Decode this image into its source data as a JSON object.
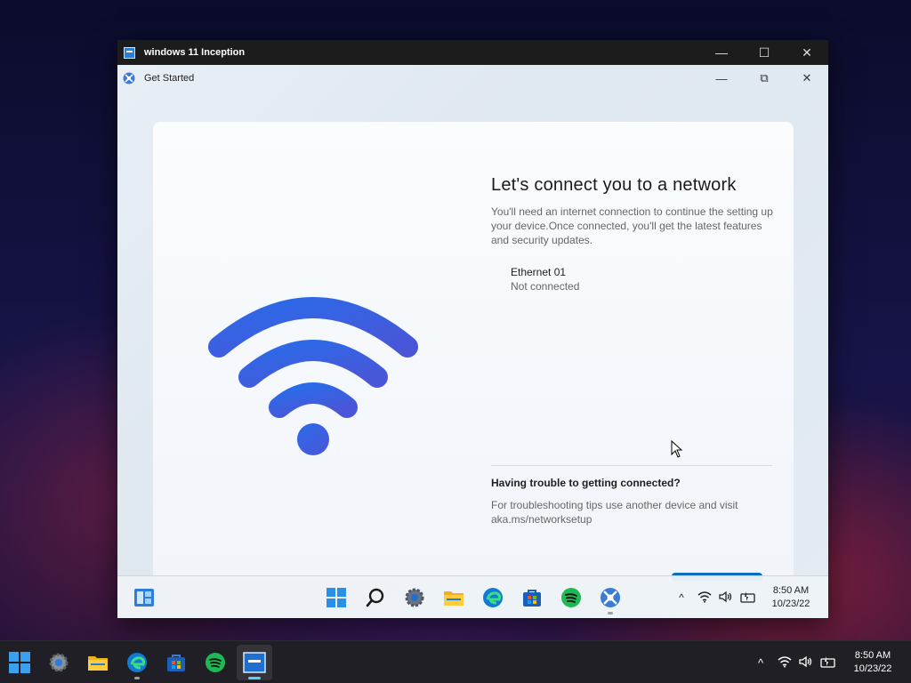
{
  "vm_window": {
    "title": "windows 11 Inception",
    "controls": {
      "minimize": "—",
      "maximize": "☐",
      "close": "✕"
    }
  },
  "oobe": {
    "title": "Get Started",
    "controls": {
      "minimize": "—",
      "restore": "⧉",
      "close": "✕"
    },
    "heading": "Let's connect you to a network",
    "description": "You'll need an internet connection to continue the setting up your device.Once connected, you'll get the latest features and security updates.",
    "network": {
      "name": "Ethernet 01",
      "status": "Not connected"
    },
    "trouble": {
      "title": "Having trouble to getting connected?",
      "text": "For troubleshooting tips use another device and visit aka.ms/networksetup"
    }
  },
  "guest_taskbar": {
    "apps": [
      "start-icon",
      "search-icon",
      "settings-icon",
      "file-explorer-icon",
      "edge-icon",
      "store-icon",
      "spotify-icon",
      "get-started-icon"
    ],
    "tray": {
      "chevron": "^",
      "clock_time": "8:50 AM",
      "clock_date": "10/23/22"
    }
  },
  "host_taskbar": {
    "apps": [
      "start-icon",
      "settings-icon",
      "file-explorer-icon",
      "edge-icon",
      "store-icon",
      "spotify-icon",
      "vm-app-icon"
    ],
    "tray": {
      "chevron": "^",
      "clock_time": "8:50 AM",
      "clock_date": "10/23/22"
    }
  },
  "colors": {
    "accent": "#0f6cbd",
    "wifi_blue": "#2f6fe0",
    "host_taskbar": "#1f1f25",
    "vm_titlebar": "#1c1c1c"
  }
}
